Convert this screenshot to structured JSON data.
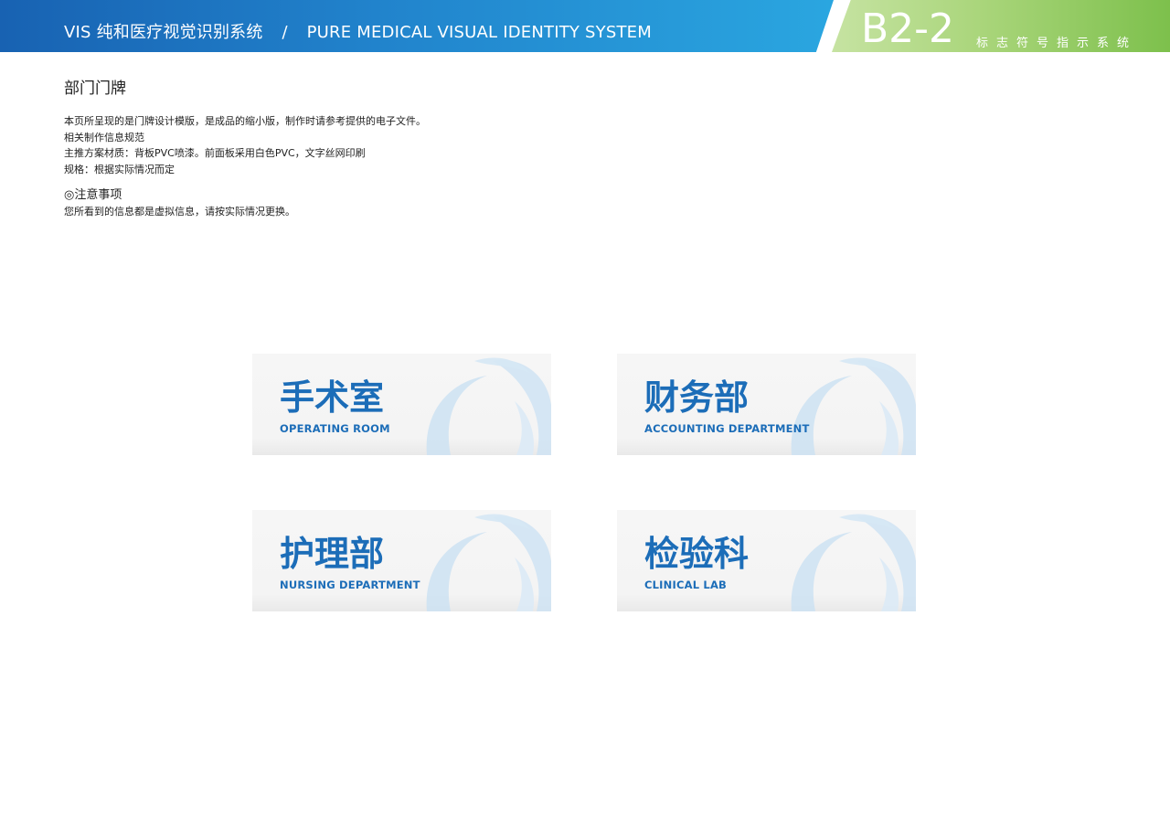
{
  "header": {
    "title_cn": "VIS  纯和医疗视觉识别系统",
    "separator": "/",
    "title_en": "PURE MEDICAL VISUAL IDENTITY SYSTEM",
    "page_code": "B2-2",
    "page_subtitle": "标志符号指示系统",
    "colors": {
      "blue": "#1862b2",
      "green": "#7dc04c"
    }
  },
  "section": {
    "title": "部门门牌",
    "lines": [
      "本页所呈现的是门牌设计模版，是成品的缩小版，制作时请参考提供的电子文件。",
      "相关制作信息规范",
      "主推方案材质：背板PVC喷漆。前面板采用白色PVC，文字丝网印刷",
      "规格：根据实际情况而定"
    ],
    "note_title": "◎注意事项",
    "note_text": "您所看到的信息都是虚拟信息，请按实际情况更换。"
  },
  "signs": [
    {
      "cn": "手术室",
      "en": "OPERATING ROOM"
    },
    {
      "cn": "财务部",
      "en": "ACCOUNTING DEPARTMENT"
    },
    {
      "cn": "护理部",
      "en": "NURSING DEPARTMENT"
    },
    {
      "cn": "检验科",
      "en": "CLINICAL LAB"
    }
  ]
}
